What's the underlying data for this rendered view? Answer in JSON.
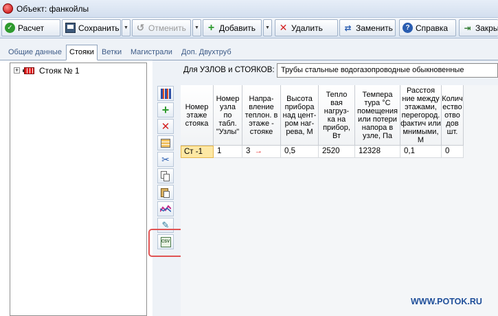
{
  "window": {
    "title": "Объект: фанкойлы"
  },
  "toolbar": {
    "calc": "Расчет",
    "save": "Сохранить",
    "undo": "Отменить",
    "add": "Добавить",
    "delete": "Удалить",
    "replace": "Заменить",
    "help": "Справка",
    "close": "Закры"
  },
  "tabs": [
    "Общие данные",
    "Стояки",
    "Ветки",
    "Магистрали",
    "Доп. Двухтруб"
  ],
  "tree": {
    "node_label": "Стояк № 1"
  },
  "nodes_label": "Для УЗЛОВ и СТОЯКОВ:",
  "pipe_type": "Трубы стальные водогазопроводные обыкновенные",
  "side_buttons": [
    "columns-icon",
    "add-icon",
    "delete-icon",
    "grid-icon",
    "cut-icon",
    "copy-icon",
    "paste-icon",
    "chart-icon",
    "tool-icon",
    "csv-icon"
  ],
  "csv_label": "CSV",
  "grid": {
    "headers": [
      "Номер\nэтаже\nстояка",
      "Номер\nузла\nпо\nтабл.\n\"Узлы\"",
      "Напра-\nвление\nтеплон. в\nэтаже -\nстояке",
      "Высота\nприбора\nнад цент-\nром наг-\nрева, М",
      "Тепло\nвая\nнагруз-\nка на\nприбор,\nВт",
      "Темпера\nтура °С\nпомещения\nили потери\nнапора в\nузле, Па",
      "Расстоя\nние  между\nэтажами,\nперегород.\nфактич или\nмнимыми,\nМ",
      "Колич\nество\nотво\nдов\nшт."
    ],
    "row": [
      "Ст -1",
      "1",
      "3",
      "0,5",
      "2520",
      "12328",
      "0,1",
      "0"
    ],
    "direction_arrow": "→"
  },
  "watermark": "WWW.POTOK.RU"
}
